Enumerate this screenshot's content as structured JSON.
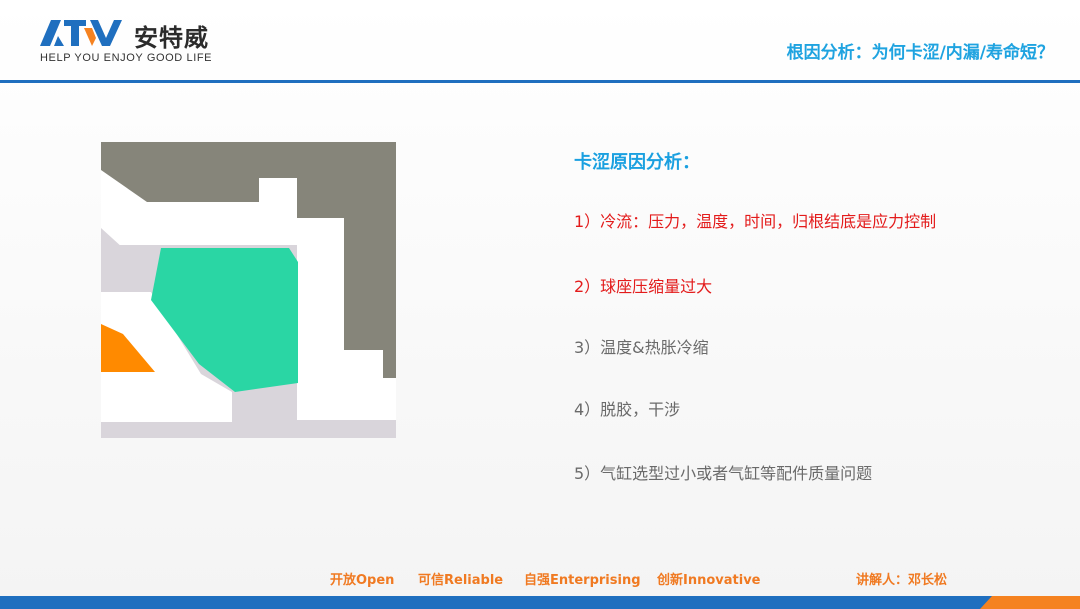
{
  "brand": {
    "logo_text": "ATV",
    "name_cn": "安特威",
    "tagline": "HELP YOU ENJOY GOOD LIFE",
    "colors": {
      "blue": "#1f6fbf",
      "accent_blue": "#1aa0e0",
      "orange": "#f58220"
    }
  },
  "header": {
    "title": "根因分析：为何卡涩/内漏/寿命短？"
  },
  "diagram": {
    "description_colors": {
      "dark": "#86857a",
      "green": "#2ad6a4",
      "orange": "#ff8a00",
      "light": "#d9d5db",
      "white": "#ffffff"
    }
  },
  "content": {
    "heading": "卡涩原因分析：",
    "items": [
      {
        "text": "1）冷流：压力，温度，时间，归根结底是应力控制",
        "color": "red"
      },
      {
        "text": "2）球座压缩量过大",
        "color": "red"
      },
      {
        "text": "3）温度&热胀冷缩",
        "color": "gray"
      },
      {
        "text": "4）脱胶，干涉",
        "color": "gray"
      },
      {
        "text": "5）气缸选型过小或者气缸等配件质量问题",
        "color": "gray"
      }
    ]
  },
  "footer": {
    "values": [
      "开放Open",
      "可信Reliable",
      "自强Enterprising",
      "创新Innovative"
    ],
    "speaker": "讲解人：邓长松"
  }
}
